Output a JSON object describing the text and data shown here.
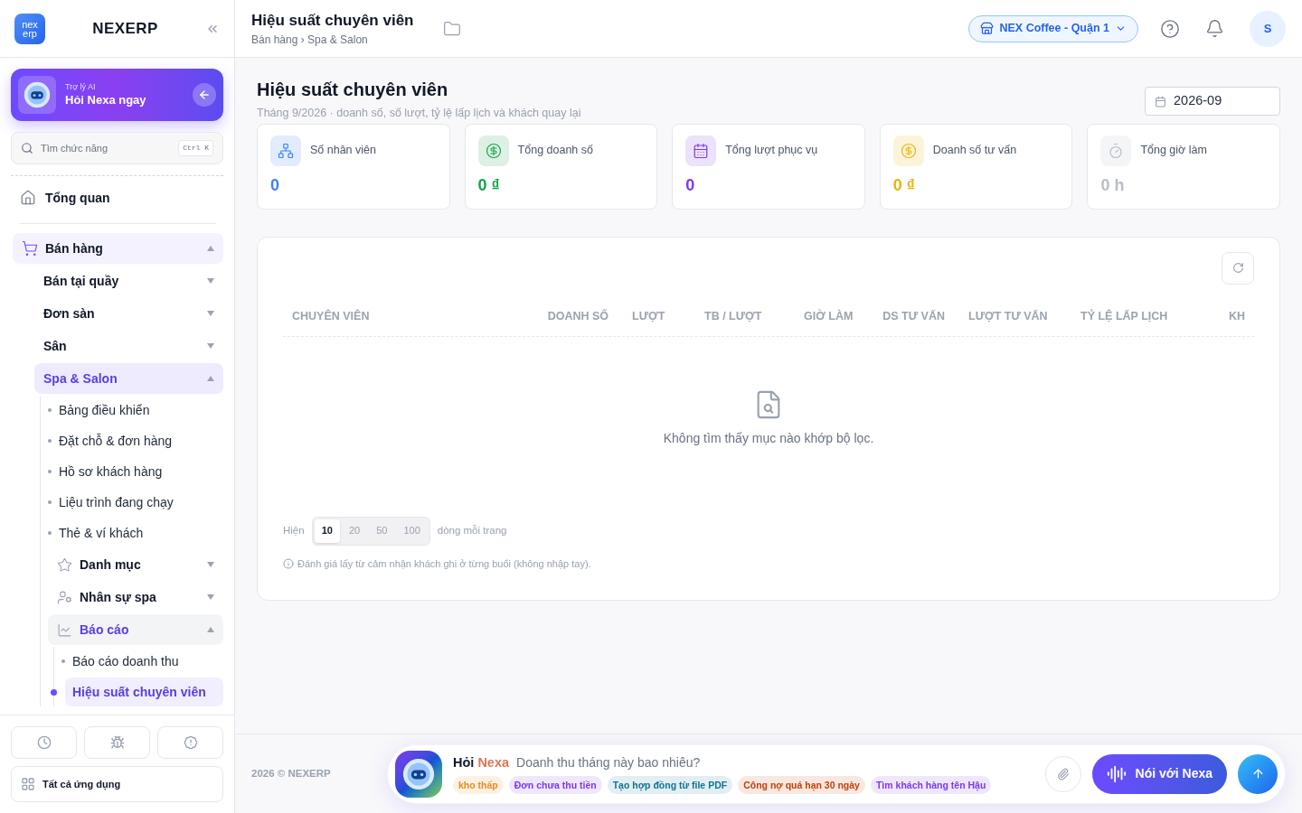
{
  "sidebar": {
    "logo": {
      "top": "nex",
      "bottom": "erp"
    },
    "brand": "NEXERP",
    "ai_card": {
      "caption": "Trợ lý AI",
      "title": "Hỏi Nexa ngay"
    },
    "search": {
      "placeholder": "Tìm chức năng",
      "shortcut": "Ctrl K"
    },
    "nav": [
      {
        "label": "Tổng quan",
        "kind": "link",
        "selected": false
      },
      {
        "label": "Bán hàng",
        "kind": "group",
        "expanded": true,
        "children": [
          {
            "label": "Bán tại quầy",
            "kind": "group",
            "expanded": false
          },
          {
            "label": "Đơn sàn",
            "kind": "group",
            "expanded": false
          },
          {
            "label": "Sân",
            "kind": "group",
            "expanded": false
          },
          {
            "label": "Spa & Salon",
            "kind": "group",
            "expanded": true,
            "children": [
              {
                "label": "Bảng điều khiển",
                "kind": "link",
                "selected": false
              },
              {
                "label": "Đặt chỗ & đơn hàng",
                "kind": "link",
                "selected": false
              },
              {
                "label": "Hồ sơ khách hàng",
                "kind": "link",
                "selected": false
              },
              {
                "label": "Liệu trình đang chạy",
                "kind": "link",
                "selected": false
              },
              {
                "label": "Thẻ & ví khách",
                "kind": "link",
                "selected": false
              },
              {
                "label": "Danh mục",
                "kind": "group",
                "expanded": false
              },
              {
                "label": "Nhân sự spa",
                "kind": "group",
                "expanded": false
              },
              {
                "label": "Báo cáo",
                "kind": "group",
                "expanded": true,
                "children": [
                  {
                    "label": "Báo cáo doanh thu",
                    "kind": "link",
                    "selected": false
                  },
                  {
                    "label": "Hiệu suất chuyên viên",
                    "kind": "link",
                    "selected": true
                  }
                ]
              }
            ]
          }
        ]
      }
    ],
    "all_apps": "Tất cả ứng dụng"
  },
  "header": {
    "title": "Hiệu suất chuyên viên",
    "breadcrumb": "Bán hàng › Spa & Salon",
    "store": "NEX Coffee - Quận 1",
    "avatar": "S"
  },
  "page": {
    "title": "Hiệu suất chuyên viên",
    "subtitle": "Tháng 9/2026 · doanh số, số lượt, tỷ lệ lấp lịch và khách quay lại",
    "month": "2026-09"
  },
  "stats": [
    {
      "label": "Số nhân viên",
      "value": "0",
      "color": "#3b82f6"
    },
    {
      "label": "Tổng doanh số",
      "value": "0 ₫",
      "color": "#16a34a"
    },
    {
      "label": "Tổng lượt phục vụ",
      "value": "0",
      "color": "#7c3aed"
    },
    {
      "label": "Doanh số tư vấn",
      "value": "0 ₫",
      "color": "#eab308"
    },
    {
      "label": "Tổng giờ làm",
      "value": "0 h",
      "color": "#b8bec8"
    }
  ],
  "table": {
    "columns": [
      "CHUYÊN VIÊN",
      "DOANH SỐ",
      "LƯỢT",
      "TB / LƯỢT",
      "GIỜ LÀM",
      "DS TƯ VẤN",
      "LƯỢT TƯ VẤN",
      "TỶ LỆ LẤP LỊCH",
      "KH"
    ],
    "empty": "Không tìm thấy mục nào khớp bộ lọc.",
    "page_size": {
      "before": "Hiện",
      "after": "dòng mỗi trang",
      "options": [
        {
          "label": "10",
          "selected": true
        },
        {
          "label": "20",
          "selected": false
        },
        {
          "label": "50",
          "selected": false
        },
        {
          "label": "100",
          "selected": false
        }
      ]
    },
    "note": "Đánh giá lấy từ cảm nhận khách ghi ở từng buổi (không nhập tay)."
  },
  "footer": {
    "copyright": "2026 © NEXERP",
    "ask": {
      "label": "Hỏi",
      "brand": "Nexa",
      "placeholder": "Doanh thu tháng này bao nhiêu?",
      "chips": [
        {
          "label": "kho thấp",
          "color": "#ea8a1e"
        },
        {
          "label": "Đơn chưa thu tiền",
          "color": "#7c3aed"
        },
        {
          "label": "Tạo hợp đồng từ file PDF",
          "color": "#0e7490"
        },
        {
          "label": "Công nợ quá hạn 30 ngày",
          "color": "#c2410c"
        },
        {
          "label": "Tìm khách hàng tên Hậu",
          "color": "#7c3aed"
        }
      ],
      "voice": "Nói với Nexa"
    }
  }
}
